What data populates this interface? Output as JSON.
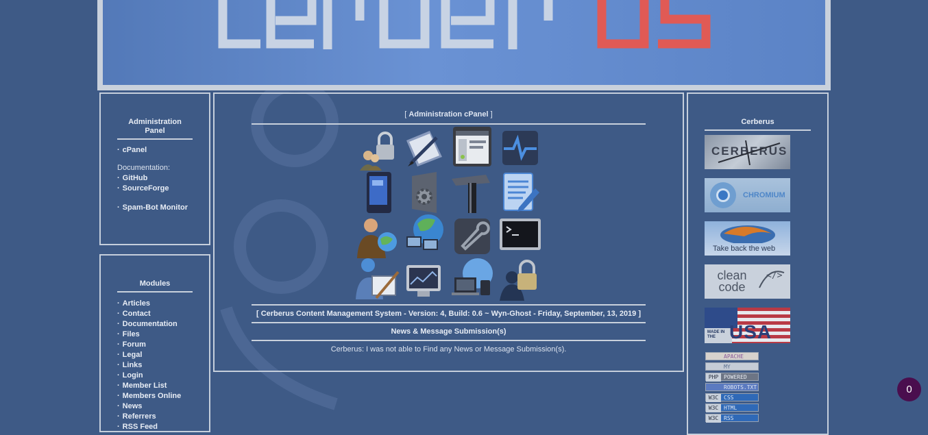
{
  "header": {
    "logo_primary": "Cerber",
    "logo_accent": "US"
  },
  "left_panel_admin": {
    "title": "Administration Panel",
    "cpanel": "cPanel",
    "documentation_label": "Documentation:",
    "github": "GitHub",
    "sourceforge": "SourceForge",
    "spam_bot_monitor": "Spam-Bot Monitor"
  },
  "left_panel_modules": {
    "title": "Modules",
    "items": [
      "Articles",
      "Contact",
      "Documentation",
      "Files",
      "Forum",
      "Legal",
      "Links",
      "Login",
      "Member List",
      "Members Online",
      "News",
      "Referrers",
      "RSS Feed"
    ]
  },
  "center": {
    "heading_prefix": "[ ",
    "heading": "Administration cPanel",
    "heading_suffix": " ]",
    "icons": [
      "users-lock-icon",
      "edit-folder-icon",
      "window-settings-icon",
      "activity-monitor-icon",
      "phone-device-icon",
      "settings-door-icon",
      "hammer-tool-icon",
      "document-edit-icon",
      "user-globe-icon",
      "network-globe-icon",
      "wrench-icon",
      "terminal-icon",
      "user-paint-icon",
      "monitor-screen-icon",
      "devices-globe-icon",
      "user-lock-icon"
    ],
    "version_line": "[ Cerberus Content Management System - Version: 4, Build: 0.6 ~ Wyn-Ghost - Friday, September, 13, 2019 ]",
    "news_heading": "News & Message Submission(s)",
    "news_message": "Cerberus: I was not able to Find any News or Message Submission(s)."
  },
  "right_panel": {
    "title": "Cerberus",
    "banners": [
      {
        "name": "cerberus-banner",
        "text": "CERBERUS"
      },
      {
        "name": "chromium-banner",
        "text": "CHROMIUM"
      },
      {
        "name": "firefox-banner",
        "text": "Take back the web"
      },
      {
        "name": "clean-code-banner",
        "text": "clean code"
      },
      {
        "name": "made-in-usa-banner",
        "text": "USA",
        "subtext": "MADE IN THE"
      }
    ],
    "mini_badges": [
      {
        "name": "apache-badge",
        "left": "",
        "right": "APACHE"
      },
      {
        "name": "mysql-badge",
        "left": "",
        "right": "MY"
      },
      {
        "name": "php-badge",
        "left": "PHP",
        "right": "POWERED"
      },
      {
        "name": "robots-badge",
        "left": "",
        "right": "ROBOTS.TXT"
      },
      {
        "name": "w3c-css-badge",
        "left": "W3C",
        "right": "CSS"
      },
      {
        "name": "w3c-html-badge",
        "left": "W3C",
        "right": "HTML"
      },
      {
        "name": "w3c-rss-badge",
        "left": "W3C",
        "right": "RSS"
      }
    ]
  },
  "counter": {
    "value": "0"
  },
  "colors": {
    "background": "#3e5a86",
    "border": "#c6cfdc",
    "accent_red": "#e0453d"
  }
}
